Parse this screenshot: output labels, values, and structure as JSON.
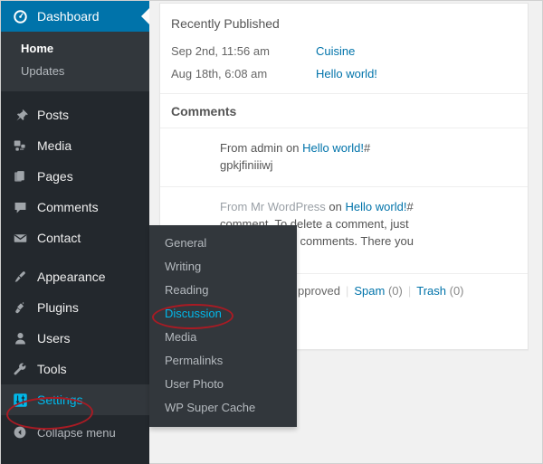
{
  "sidebar": {
    "dashboard": {
      "label": "Dashboard",
      "icon": "dashboard-gauge-icon",
      "submenu": [
        {
          "label": "Home",
          "current": true
        },
        {
          "label": "Updates",
          "current": false
        }
      ]
    },
    "items": [
      {
        "label": "Posts",
        "icon": "pushpin-icon"
      },
      {
        "label": "Media",
        "icon": "media-camera-icon"
      },
      {
        "label": "Pages",
        "icon": "pages-icon"
      },
      {
        "label": "Comments",
        "icon": "comment-bubble-icon"
      },
      {
        "label": "Contact",
        "icon": "envelope-icon"
      },
      {
        "label": "Appearance",
        "icon": "paintbrush-icon"
      },
      {
        "label": "Plugins",
        "icon": "plug-icon"
      },
      {
        "label": "Users",
        "icon": "user-icon"
      },
      {
        "label": "Tools",
        "icon": "wrench-icon"
      },
      {
        "label": "Settings",
        "icon": "settings-sliders-icon"
      }
    ],
    "collapse": {
      "label": "Collapse menu",
      "icon": "collapse-arrow-icon"
    }
  },
  "settings_flyout": {
    "items": [
      {
        "label": "General"
      },
      {
        "label": "Writing"
      },
      {
        "label": "Reading"
      },
      {
        "label": "Discussion",
        "highlighted": true
      },
      {
        "label": "Media"
      },
      {
        "label": "Permalinks"
      },
      {
        "label": "User Photo"
      },
      {
        "label": "WP Super Cache"
      }
    ]
  },
  "recently_published": {
    "title": "Recently Published",
    "rows": [
      {
        "date": "Sep 2nd, 11:56 am",
        "post": "Cuisine"
      },
      {
        "date": "Aug 18th, 6:08 am",
        "post": "Hello world!"
      }
    ]
  },
  "comments": {
    "title": "Comments",
    "list": [
      {
        "from_prefix": "From",
        "author": "admin",
        "on": "on",
        "post": "Hello world!",
        "hash": "#",
        "body": "gpkjfiniiiwj"
      },
      {
        "from_prefix": "From",
        "author": "Mr WordPress",
        "on": "on",
        "post": "Hello world!",
        "hash": "#",
        "body_line1": "comment. To delete a comment, just",
        "body_line2": "view the post's comments. There you"
      }
    ],
    "status": {
      "approved": "pproved",
      "spam_label": "Spam",
      "spam_count": "(0)",
      "trash_label": "Trash",
      "trash_count": "(0)"
    }
  },
  "colors": {
    "sidebar_bg": "#23282d",
    "sidebar_sub_bg": "#32373c",
    "accent_blue": "#0073aa",
    "highlight_teal": "#00b9eb",
    "annotation_red": "#a81b24",
    "page_bg": "#f1f1f1"
  }
}
